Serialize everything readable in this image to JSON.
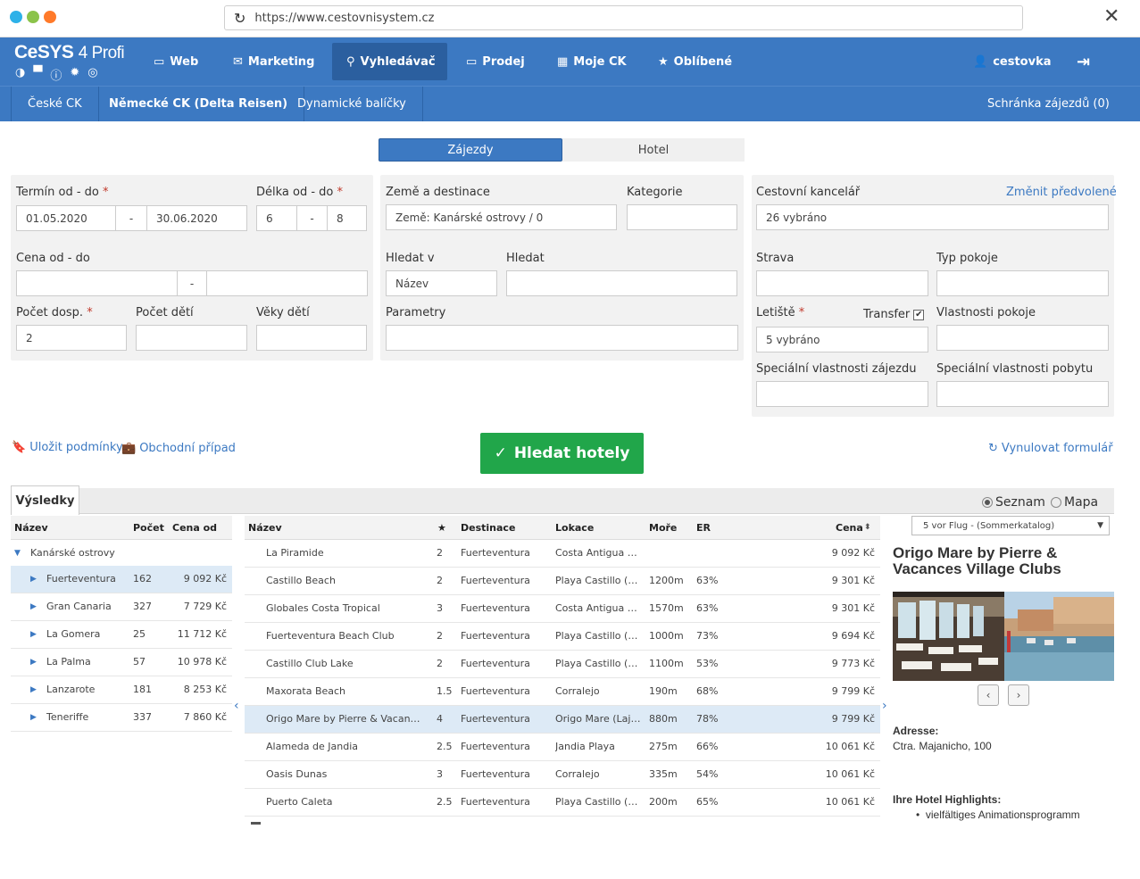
{
  "browser": {
    "url": "https://www.cestovnisystem.cz"
  },
  "brand": {
    "name": "CeSYS",
    "edition": "4 Profi"
  },
  "nav": {
    "web": "Web",
    "marketing": "Marketing",
    "search": "Vyhledávač",
    "sales": "Prodej",
    "my_agency": "Moje CK",
    "favorites": "Oblíbené",
    "user": "cestovka"
  },
  "subnav": {
    "czech": "České CK",
    "german": "Německé CK (Delta Reisen)",
    "packages": "Dynamické balíčky",
    "basket": "Schránka zájezdů (0)"
  },
  "toggle": {
    "tours": "Zájezdy",
    "hotel": "Hotel"
  },
  "form": {
    "term_label": "Termín od - do",
    "term_from": "01.05.2020",
    "term_sep": "-",
    "term_to": "30.06.2020",
    "length_label": "Délka od - do",
    "length_from": "6",
    "length_sep": "-",
    "length_to": "8",
    "country_label": "Země a destinace",
    "country_value": "Země: Kanárské ostrovy / 0",
    "category_label": "Kategorie",
    "agency_label": "Cestovní kancelář",
    "agency_change": "Změnit předvolené",
    "agency_value": "26 vybráno",
    "price_label": "Cena od - do",
    "price_sep": "-",
    "search_in_label": "Hledat v",
    "search_in_value": "Název",
    "search_label": "Hledat",
    "board_label": "Strava",
    "room_type_label": "Typ pokoje",
    "adults_label": "Počet dosp.",
    "adults_value": "2",
    "children_label": "Počet dětí",
    "ages_label": "Věky dětí",
    "params_label": "Parametry",
    "airport_label": "Letiště",
    "transfer_label": "Transfer",
    "airport_value": "5 vybráno",
    "room_props_label": "Vlastnosti pokoje",
    "special_tour_label": "Speciální vlastnosti zájezdu",
    "special_stay_label": "Speciální vlastnosti pobytu",
    "required_mark": "*"
  },
  "actions": {
    "save": "Uložit podmínky",
    "business": "Obchodní případ",
    "search": "Hledat hotely",
    "reset": "Vynulovat formulář"
  },
  "results": {
    "tab": "Výsledky",
    "view_list": "Seznam",
    "view_map": "Mapa"
  },
  "dest_table": {
    "headers": {
      "name": "Název",
      "count": "Počet",
      "price": "Cena od"
    },
    "group": "Kanárské ostrovy",
    "rows": [
      {
        "name": "Fuerteventura",
        "count": "162",
        "price": "9 092 Kč"
      },
      {
        "name": "Gran Canaria",
        "count": "327",
        "price": "7 729 Kč"
      },
      {
        "name": "La Gomera",
        "count": "25",
        "price": "11 712 Kč"
      },
      {
        "name": "La Palma",
        "count": "57",
        "price": "10 978 Kč"
      },
      {
        "name": "Lanzarote",
        "count": "181",
        "price": "8 253 Kč"
      },
      {
        "name": "Teneriffe",
        "count": "337",
        "price": "7 860 Kč"
      }
    ]
  },
  "hotel_table": {
    "headers": {
      "name": "Název",
      "star": "★",
      "dest": "Destinace",
      "loc": "Lokace",
      "sea": "Moře",
      "er": "ER",
      "price": "Cena"
    },
    "rows": [
      {
        "name": "La Piramide",
        "stars": "2",
        "dest": "Fuerteventura",
        "loc": "Costa Antigua (N...",
        "sea": "",
        "er": "",
        "price": "9 092 Kč"
      },
      {
        "name": "Castillo Beach",
        "stars": "2",
        "dest": "Fuerteventura",
        "loc": "Playa Castillo (C...",
        "sea": "1200m",
        "er": "63%",
        "price": "9 301 Kč"
      },
      {
        "name": "Globales Costa Tropical",
        "stars": "3",
        "dest": "Fuerteventura",
        "loc": "Costa Antigua (N...",
        "sea": "1570m",
        "er": "63%",
        "price": "9 301 Kč"
      },
      {
        "name": "Fuerteventura Beach Club",
        "stars": "2",
        "dest": "Fuerteventura",
        "loc": "Playa Castillo (C...",
        "sea": "1000m",
        "er": "73%",
        "price": "9 694 Kč"
      },
      {
        "name": "Castillo Club Lake",
        "stars": "2",
        "dest": "Fuerteventura",
        "loc": "Playa Castillo (C...",
        "sea": "1100m",
        "er": "53%",
        "price": "9 773 Kč"
      },
      {
        "name": "Maxorata Beach",
        "stars": "1.5",
        "dest": "Fuerteventura",
        "loc": "Corralejo",
        "sea": "190m",
        "er": "68%",
        "price": "9 799 Kč"
      },
      {
        "name": "Origo Mare by Pierre & Vacances ...",
        "stars": "4",
        "dest": "Fuerteventura",
        "loc": "Origo Mare (Laja...",
        "sea": "880m",
        "er": "78%",
        "price": "9 799 Kč"
      },
      {
        "name": "Alameda de Jandia",
        "stars": "2.5",
        "dest": "Fuerteventura",
        "loc": "Jandia Playa",
        "sea": "275m",
        "er": "66%",
        "price": "10 061 Kč"
      },
      {
        "name": "Oasis Dunas",
        "stars": "3",
        "dest": "Fuerteventura",
        "loc": "Corralejo",
        "sea": "335m",
        "er": "54%",
        "price": "10 061 Kč"
      },
      {
        "name": "Puerto Caleta",
        "stars": "2.5",
        "dest": "Fuerteventura",
        "loc": "Playa Castillo (C...",
        "sea": "200m",
        "er": "65%",
        "price": "10 061 Kč"
      }
    ]
  },
  "detail": {
    "catalog": "5 vor Flug - (Sommerkatalog)",
    "title": "Origo Mare by Pierre & Vacances Village Clubs",
    "address_label": "Adresse:",
    "address": "Ctra. Majanicho, 100",
    "highlights_label": "Ihre Hotel Highlights:",
    "highlight_1": "vielfältiges Animationsprogramm"
  },
  "colors": {
    "primary": "#3c79c2",
    "primary_dark": "#2b5f9f",
    "success": "#21a64a",
    "panel": "#f2f2f2",
    "selected_row": "#ddeaf6"
  }
}
